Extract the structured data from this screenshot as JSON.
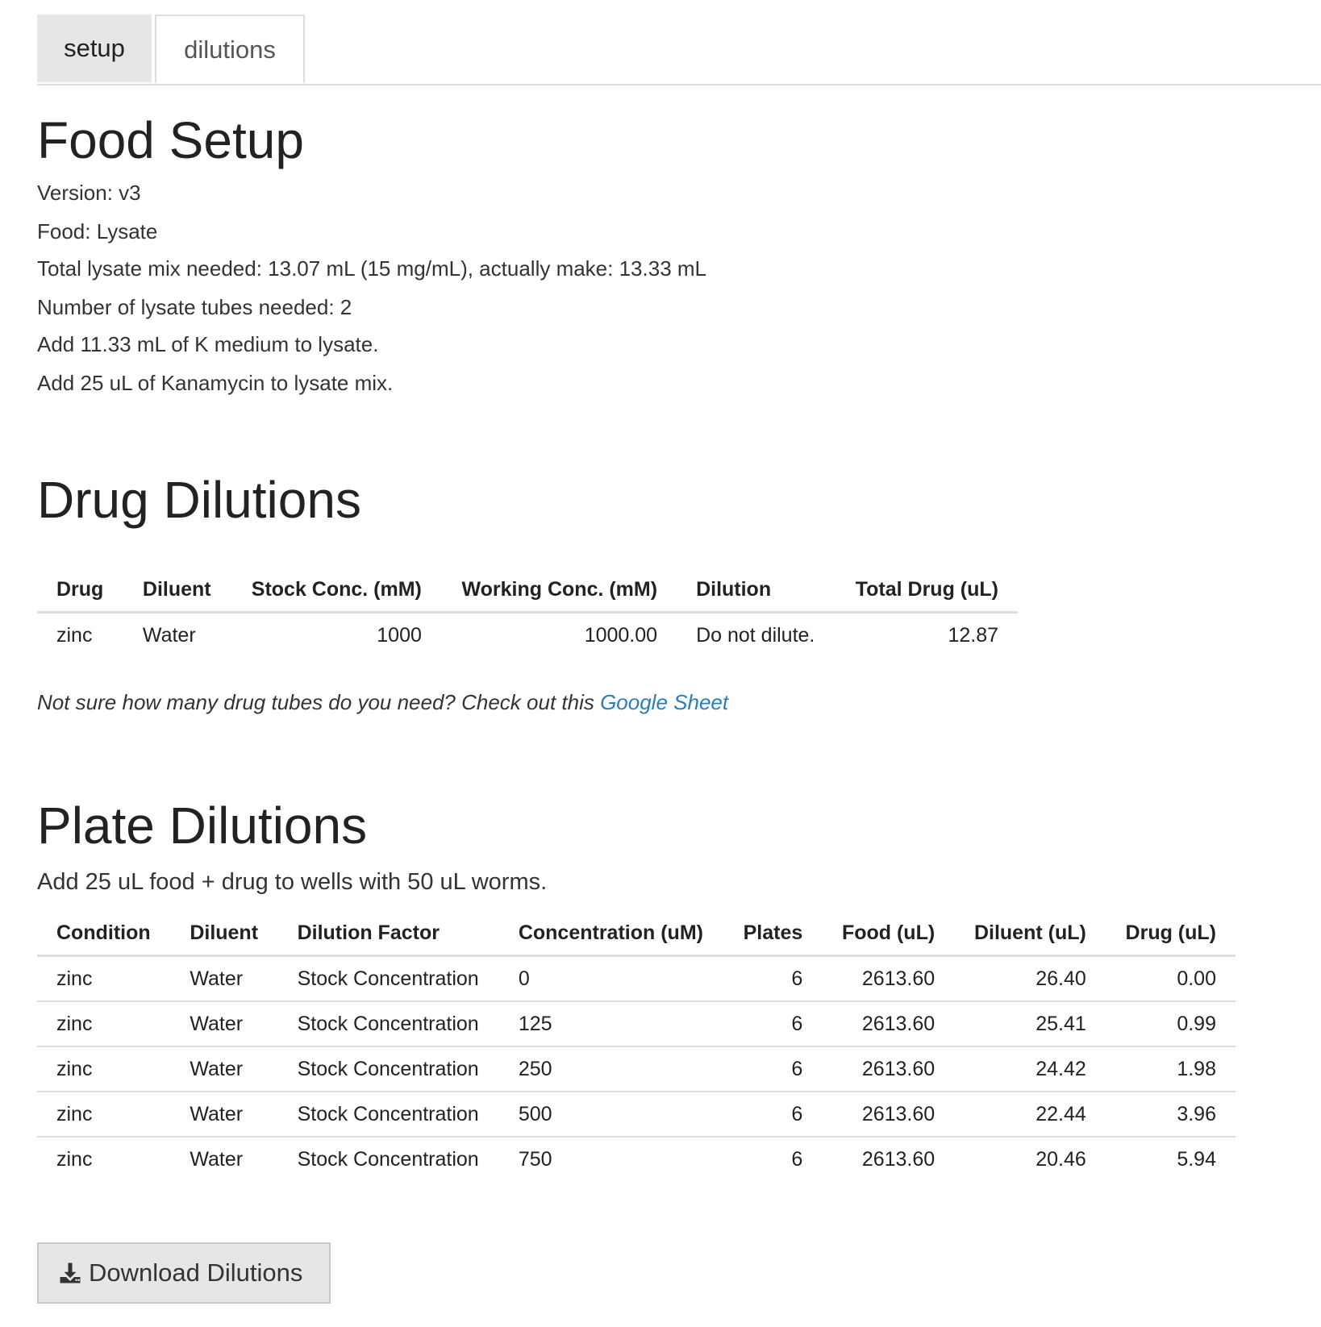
{
  "tabs": [
    {
      "label": "setup",
      "active": false
    },
    {
      "label": "dilutions",
      "active": true
    }
  ],
  "food_setup": {
    "title": "Food Setup",
    "lines": [
      "Version: v3",
      "Food: Lysate",
      "Total lysate mix needed: 13.07 mL (15 mg/mL), actually make: 13.33 mL",
      "Number of lysate tubes needed: 2",
      "Add 11.33 mL of K medium to lysate.",
      "Add 25 uL of Kanamycin to lysate mix."
    ]
  },
  "drug_dilutions": {
    "title": "Drug Dilutions",
    "headers": [
      "Drug",
      "Diluent",
      "Stock Conc. (mM)",
      "Working Conc. (mM)",
      "Dilution",
      "Total Drug (uL)"
    ],
    "rows": [
      [
        "zinc",
        "Water",
        "1000",
        "1000.00",
        "Do not dilute.",
        "12.87"
      ]
    ],
    "note_text": "Not sure how many drug tubes do you need? Check out this ",
    "note_link": "Google Sheet"
  },
  "plate_dilutions": {
    "title": "Plate Dilutions",
    "subtitle": "Add 25 uL food + drug to wells with 50 uL worms.",
    "headers": [
      "Condition",
      "Diluent",
      "Dilution Factor",
      "Concentration (uM)",
      "Plates",
      "Food (uL)",
      "Diluent (uL)",
      "Drug (uL)"
    ],
    "rows": [
      [
        "zinc",
        "Water",
        "Stock Concentration",
        "0",
        "6",
        "2613.60",
        "26.40",
        "0.00"
      ],
      [
        "zinc",
        "Water",
        "Stock Concentration",
        "125",
        "6",
        "2613.60",
        "25.41",
        "0.99"
      ],
      [
        "zinc",
        "Water",
        "Stock Concentration",
        "250",
        "6",
        "2613.60",
        "24.42",
        "1.98"
      ],
      [
        "zinc",
        "Water",
        "Stock Concentration",
        "500",
        "6",
        "2613.60",
        "22.44",
        "3.96"
      ],
      [
        "zinc",
        "Water",
        "Stock Concentration",
        "750",
        "6",
        "2613.60",
        "20.46",
        "5.94"
      ]
    ]
  },
  "download": {
    "label": "Download Dilutions",
    "icon": "download-icon"
  }
}
